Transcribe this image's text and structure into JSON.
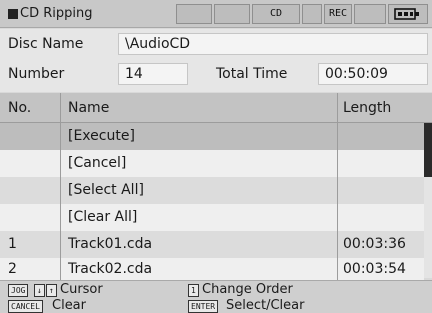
{
  "titlebar": {
    "title": "CD Ripping",
    "indicator_cd": "CD",
    "indicator_rec": "REC",
    "icon": "battery-icon"
  },
  "info": {
    "disc_name_label": "Disc Name",
    "disc_name_value": "\\AudioCD",
    "number_label": "Number",
    "number_value": "14",
    "total_time_label": "Total Time",
    "total_time_value": "00:50:09"
  },
  "list": {
    "headers": {
      "no": "No.",
      "name": "Name",
      "length": "Length"
    },
    "rows": [
      {
        "no": "",
        "name": "[Execute]",
        "length": ""
      },
      {
        "no": "",
        "name": "[Cancel]",
        "length": ""
      },
      {
        "no": "",
        "name": "[Select All]",
        "length": ""
      },
      {
        "no": "",
        "name": "[Clear All]",
        "length": ""
      },
      {
        "no": "1",
        "name": "Track01.cda",
        "length": "00:03:36"
      },
      {
        "no": "2",
        "name": "Track02.cda",
        "length": "00:03:54"
      }
    ]
  },
  "footer": {
    "jog_key": "JOG",
    "arrow_down": "↓",
    "arrow_up": "↑",
    "cursor_label": "Cursor",
    "one_key": "1",
    "change_order_label": "Change Order",
    "cancel_key": "CANCEL",
    "clear_label": "Clear",
    "enter_key": "ENTER",
    "select_clear_label": "Select/Clear"
  }
}
